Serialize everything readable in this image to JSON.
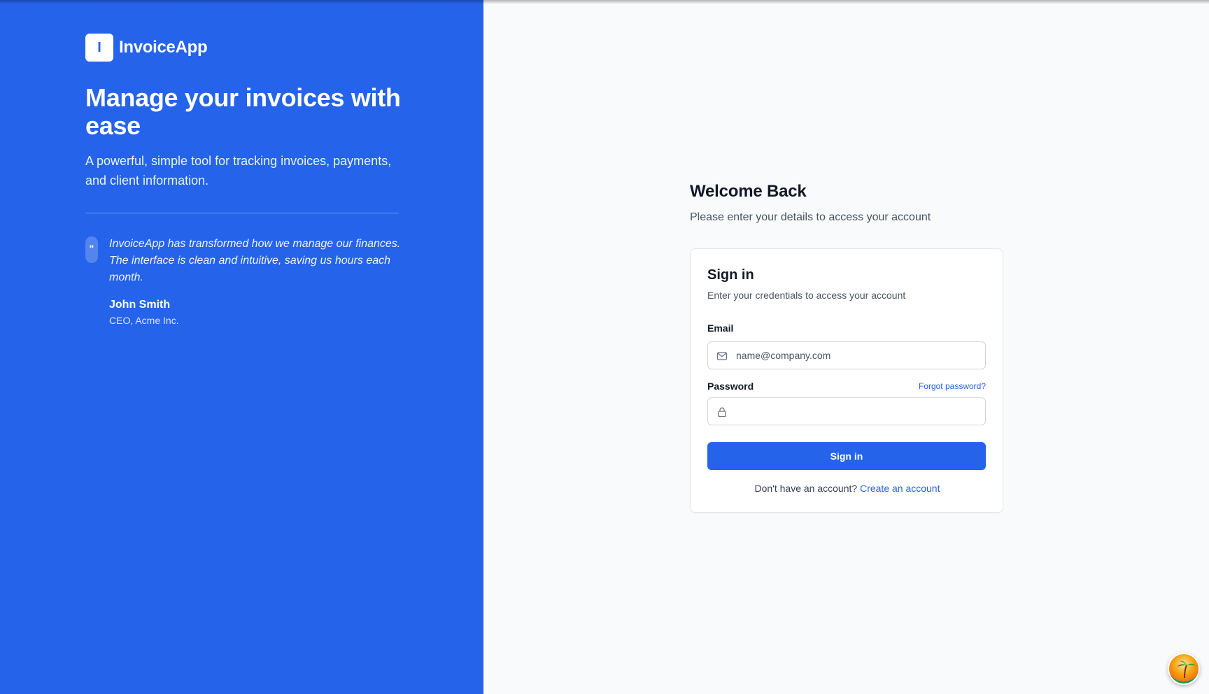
{
  "brand": {
    "logo_letter": "I",
    "name": "InvoiceApp"
  },
  "hero": {
    "title": "Manage your invoices with ease",
    "subtitle": "A powerful, simple tool for tracking invoices, payments, and client information."
  },
  "testimonial": {
    "quote_mark": "\"",
    "quote": "InvoiceApp has transformed how we manage our finances. The interface is clean and intuitive, saving us hours each month.",
    "author": "John Smith",
    "role": "CEO, Acme Inc."
  },
  "welcome": {
    "title": "Welcome Back",
    "subtitle": "Please enter your details to access your account"
  },
  "form": {
    "title": "Sign in",
    "subtitle": "Enter your credentials to access your account",
    "email_label": "Email",
    "email_placeholder": "name@company.com",
    "email_value": "",
    "password_label": "Password",
    "password_placeholder": "",
    "password_value": "",
    "forgot_label": "Forgot password?",
    "submit_label": "Sign in",
    "signup_prompt": "Don't have an account?",
    "signup_link": "Create an account"
  },
  "icons": {
    "email": "mail-icon",
    "password": "lock-icon",
    "assistant": "avatar-badge"
  },
  "colors": {
    "accent": "#2563eb",
    "background": "#f8fafc",
    "text": "#111827"
  }
}
